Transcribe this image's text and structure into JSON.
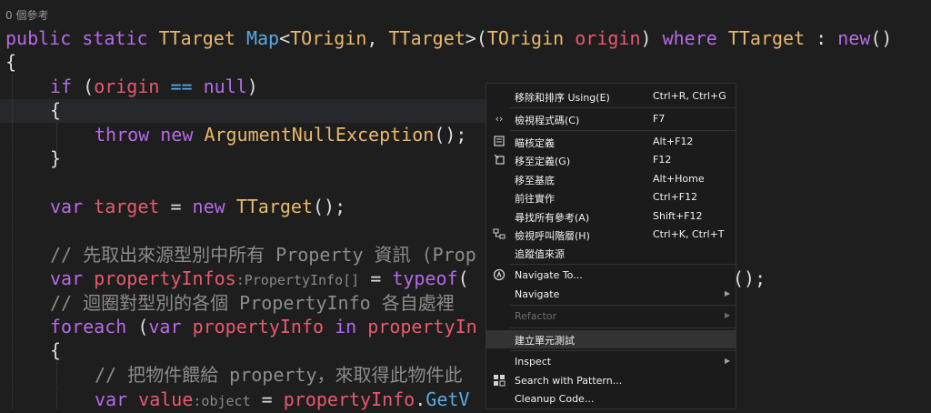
{
  "editor": {
    "codelens": "0 個參考",
    "lines": {
      "l1": {
        "a": "public",
        "b": "static",
        "c": "TTarget",
        "d": "Map",
        "e": "<",
        "f": "TOrigin",
        "g": ", ",
        "h": "TTarget",
        "i": ">(",
        "j": "TOrigin",
        "k": "origin",
        "l": ") ",
        "m": "where",
        "n": "TTarget",
        "o": " : ",
        "p": "new",
        "q": "()"
      },
      "l2": {
        "a": "{"
      },
      "l3": {
        "a": "if",
        "b": " (",
        "c": "origin",
        "d": " == ",
        "e": "null",
        "f": ")"
      },
      "l4": {
        "a": "{"
      },
      "l5": {
        "a": "throw",
        "b": "new",
        "c": "ArgumentNullException",
        "d": "();"
      },
      "l6": {
        "a": "}"
      },
      "l7": {
        "a": "var",
        "b": "target",
        "c": " = ",
        "d": "new",
        "e": "TTarget",
        "f": "();"
      },
      "l8": {
        "a": "// 先取出來源型別中所有 Property 資訊 (Prop"
      },
      "l9": {
        "a": "var",
        "b": "propertyInfos",
        "c": ":PropertyInfo[]",
        "d": " = ",
        "e": "typeof",
        "f": "(",
        "g": "();"
      },
      "l10": {
        "a": "// 迴圈對型別的各個 PropertyInfo 各自處裡"
      },
      "l11": {
        "a": "foreach",
        "b": " (",
        "c": "var",
        "d": "propertyInfo",
        "e": "in",
        "f": "propertyIn"
      },
      "l12": {
        "a": "{"
      },
      "l13": {
        "a": "// 把物件餵給 property，來取得此物件此"
      },
      "l14": {
        "a": "var",
        "b": "value",
        "c": ":object",
        "d": " = ",
        "e": "propertyInfo",
        "f": ".",
        "g": "GetV"
      }
    }
  },
  "context_menu": {
    "items": [
      {
        "label": "移除和排序 Using(E)",
        "shortcut": "Ctrl+R, Ctrl+G",
        "icon": ""
      },
      {
        "label": "檢視程式碼(C)",
        "shortcut": "F7",
        "icon": "code-brackets-icon"
      },
      {
        "label": "瞄核定義",
        "shortcut": "Alt+F12",
        "icon": "peek-definition-icon"
      },
      {
        "label": "移至定義(G)",
        "shortcut": "F12",
        "icon": "go-to-definition-icon"
      },
      {
        "label": "移至基底",
        "shortcut": "Alt+Home",
        "icon": ""
      },
      {
        "label": "前往實作",
        "shortcut": "Ctrl+F12",
        "icon": ""
      },
      {
        "label": "尋找所有參考(A)",
        "shortcut": "Shift+F12",
        "icon": ""
      },
      {
        "label": "檢視呼叫階層(H)",
        "shortcut": "Ctrl+K, Ctrl+T",
        "icon": "call-hierarchy-icon"
      },
      {
        "label": "追蹤值來源",
        "shortcut": "",
        "icon": ""
      },
      {
        "label": "Navigate To...",
        "shortcut": "",
        "icon": "navigate-to-icon"
      },
      {
        "label": "Navigate",
        "shortcut": "",
        "icon": "",
        "submenu": true
      },
      {
        "label": "Refactor",
        "shortcut": "",
        "icon": "",
        "submenu": true,
        "disabled": true
      },
      {
        "label": "建立單元測試",
        "shortcut": "",
        "icon": "",
        "selected": true
      },
      {
        "label": "Inspect",
        "shortcut": "",
        "icon": "",
        "submenu": true
      },
      {
        "label": "Search with Pattern...",
        "shortcut": "",
        "icon": "search-pattern-icon"
      },
      {
        "label": "Cleanup Code...",
        "shortcut": "",
        "icon": ""
      }
    ]
  }
}
